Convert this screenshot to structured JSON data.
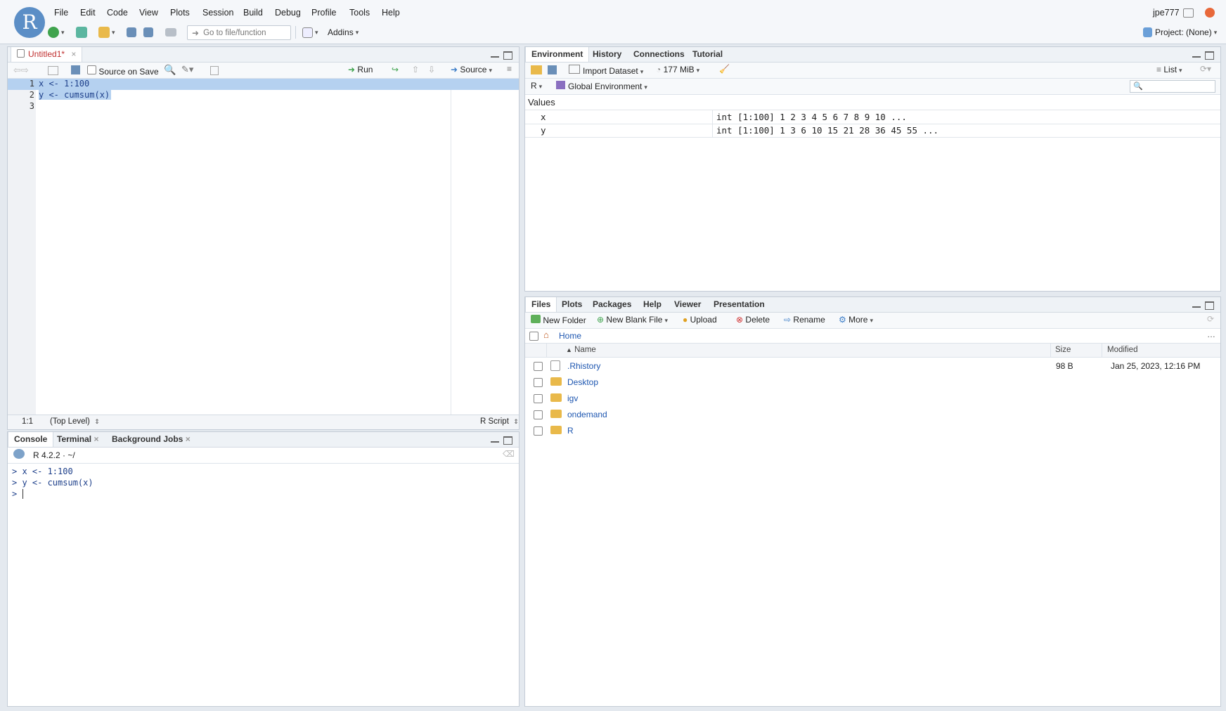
{
  "menu": [
    "File",
    "Edit",
    "Code",
    "View",
    "Plots",
    "Session",
    "Build",
    "Debug",
    "Profile",
    "Tools",
    "Help"
  ],
  "logo_letter": "R",
  "user": "jpe777",
  "toolbar": {
    "goto_placeholder": "Go to file/function",
    "addins": "Addins",
    "project": "Project: (None)"
  },
  "editor": {
    "tab_label": "Untitled1*",
    "source_on_save": "Source on Save",
    "run": "Run",
    "source": "Source",
    "lines": [
      {
        "num": "1",
        "code": "x <- 1:100"
      },
      {
        "num": "2",
        "code": "y <- cumsum(x)"
      },
      {
        "num": "3",
        "code": ""
      }
    ],
    "status_pos": "1:1",
    "status_scope": "(Top Level)",
    "status_type": "R Script"
  },
  "console": {
    "tabs": [
      "Console",
      "Terminal",
      "Background Jobs"
    ],
    "version": "R 4.2.2 · ~/",
    "lines": [
      "> x <- 1:100",
      "> y <- cumsum(x)",
      "> "
    ]
  },
  "environment": {
    "tabs": [
      "Environment",
      "History",
      "Connections",
      "Tutorial"
    ],
    "import_dataset": "Import Dataset",
    "memory": "177 MiB",
    "view_mode": "List",
    "lang": "R",
    "scope": "Global Environment",
    "section": "Values",
    "values": [
      {
        "name": "x",
        "value": "int [1:100] 1 2 3 4 5 6 7 8 9 10 ..."
      },
      {
        "name": "y",
        "value": "int [1:100] 1 3 6 10 15 21 28 36 45 55 ..."
      }
    ]
  },
  "files": {
    "tabs": [
      "Files",
      "Plots",
      "Packages",
      "Help",
      "Viewer",
      "Presentation"
    ],
    "actions": {
      "new_folder": "New Folder",
      "new_blank_file": "New Blank File",
      "upload": "Upload",
      "delete": "Delete",
      "rename": "Rename",
      "more": "More"
    },
    "path": "Home",
    "columns": {
      "name": "Name",
      "size": "Size",
      "modified": "Modified"
    },
    "rows": [
      {
        "name": ".Rhistory",
        "size": "98 B",
        "modified": "Jan 25, 2023, 12:16 PM"
      },
      {
        "name": "Desktop",
        "size": "",
        "modified": ""
      },
      {
        "name": "igv",
        "size": "",
        "modified": ""
      },
      {
        "name": "ondemand",
        "size": "",
        "modified": ""
      },
      {
        "name": "R",
        "size": "",
        "modified": ""
      }
    ]
  },
  "colors": {
    "accent": "#1d56b0",
    "selection": "#b5d1f0",
    "logo": "#5b8ec6"
  }
}
